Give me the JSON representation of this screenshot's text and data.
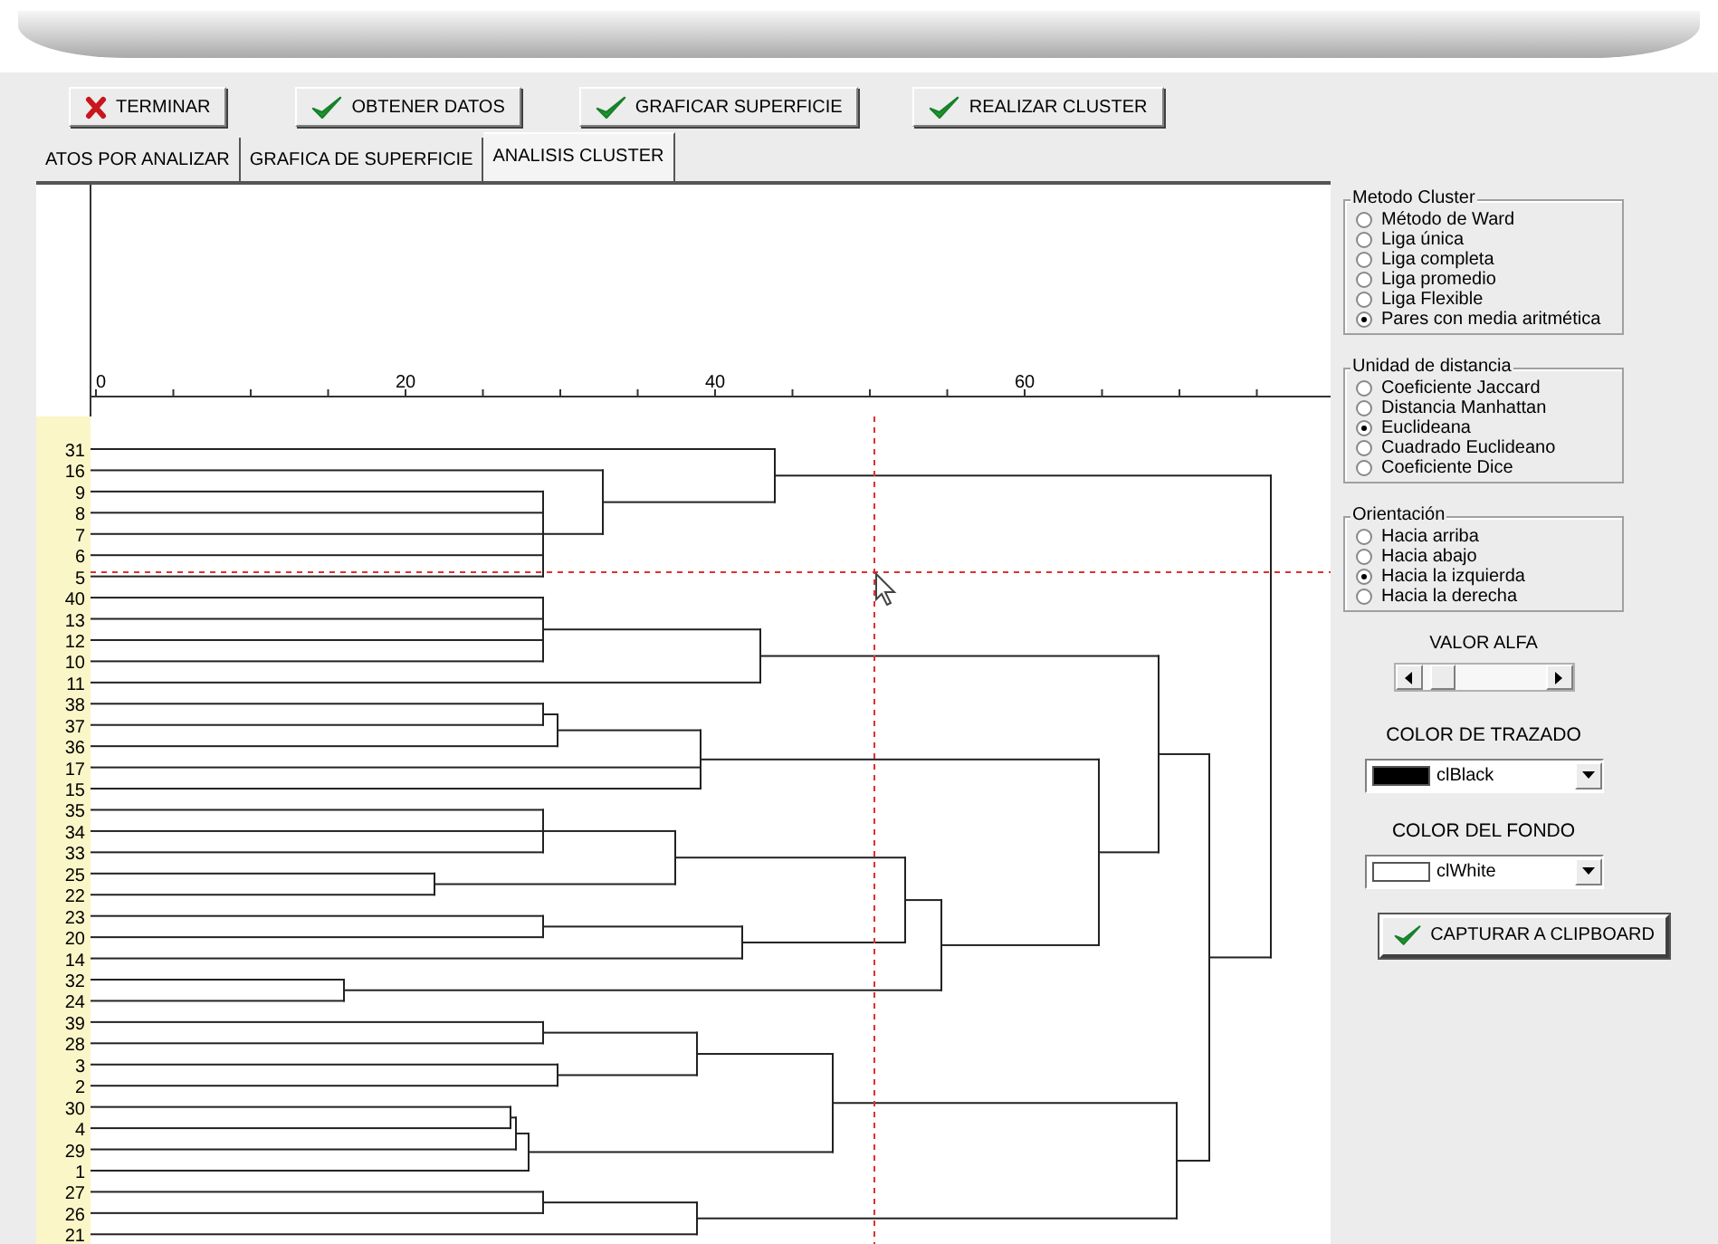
{
  "toolbar": [
    {
      "label": "TERMINAR",
      "kind": "cancel"
    },
    {
      "label": "OBTENER DATOS",
      "kind": "confirm"
    },
    {
      "label": "GRAFICAR SUPERFICIE",
      "kind": "confirm"
    },
    {
      "label": "REALIZAR CLUSTER",
      "kind": "confirm"
    }
  ],
  "tabs": [
    {
      "label": "ATOS POR ANALIZAR",
      "selected": false
    },
    {
      "label": "GRAFICA DE SUPERFICIE",
      "selected": false
    },
    {
      "label": "ANALISIS CLUSTER",
      "selected": true
    }
  ],
  "dendrogram": {
    "axis_ticks": [
      "0",
      "20",
      "40",
      "60"
    ],
    "leaf_labels": [
      "31",
      "16",
      "9",
      "8",
      "7",
      "6",
      "5",
      "40",
      "13",
      "12",
      "10",
      "11",
      "38",
      "37",
      "36",
      "17",
      "15",
      "35",
      "34",
      "33",
      "25",
      "22",
      "23",
      "20",
      "14",
      "32",
      "24",
      "39",
      "28",
      "3",
      "2",
      "30",
      "4",
      "29",
      "1",
      "27",
      "26",
      "21"
    ]
  },
  "options": [
    {
      "title": "Metodo Cluster",
      "items": [
        {
          "label": "Método de Ward",
          "selected": false
        },
        {
          "label": "Liga única",
          "selected": false
        },
        {
          "label": "Liga completa",
          "selected": false
        },
        {
          "label": "Liga promedio",
          "selected": false
        },
        {
          "label": "Liga Flexible",
          "selected": false
        },
        {
          "label": "Pares con media aritmética",
          "selected": true
        }
      ]
    },
    {
      "title": "Unidad de distancia",
      "items": [
        {
          "label": "Coeficiente Jaccard",
          "selected": false
        },
        {
          "label": "Distancia Manhattan",
          "selected": false
        },
        {
          "label": "Euclideana",
          "selected": true
        },
        {
          "label": "Cuadrado Euclideano",
          "selected": false
        },
        {
          "label": "Coeficiente Dice",
          "selected": false
        }
      ]
    },
    {
      "title": "Orientación",
      "items": [
        {
          "label": "Hacia arriba",
          "selected": false
        },
        {
          "label": "Hacia abajo",
          "selected": false
        },
        {
          "label": "Hacia la izquierda",
          "selected": true
        },
        {
          "label": "Hacia la derecha",
          "selected": false
        }
      ]
    }
  ],
  "alpha": {
    "label": "VALOR ALFA"
  },
  "color_pickers": [
    {
      "label": "COLOR DE TRAZADO",
      "value": "clBlack",
      "color": "#000000"
    },
    {
      "label": "COLOR DEL FONDO",
      "value": "clWhite",
      "color": "#ffffff"
    }
  ],
  "capture_button": {
    "label": "CAPTURAR A CLIPBOARD"
  }
}
